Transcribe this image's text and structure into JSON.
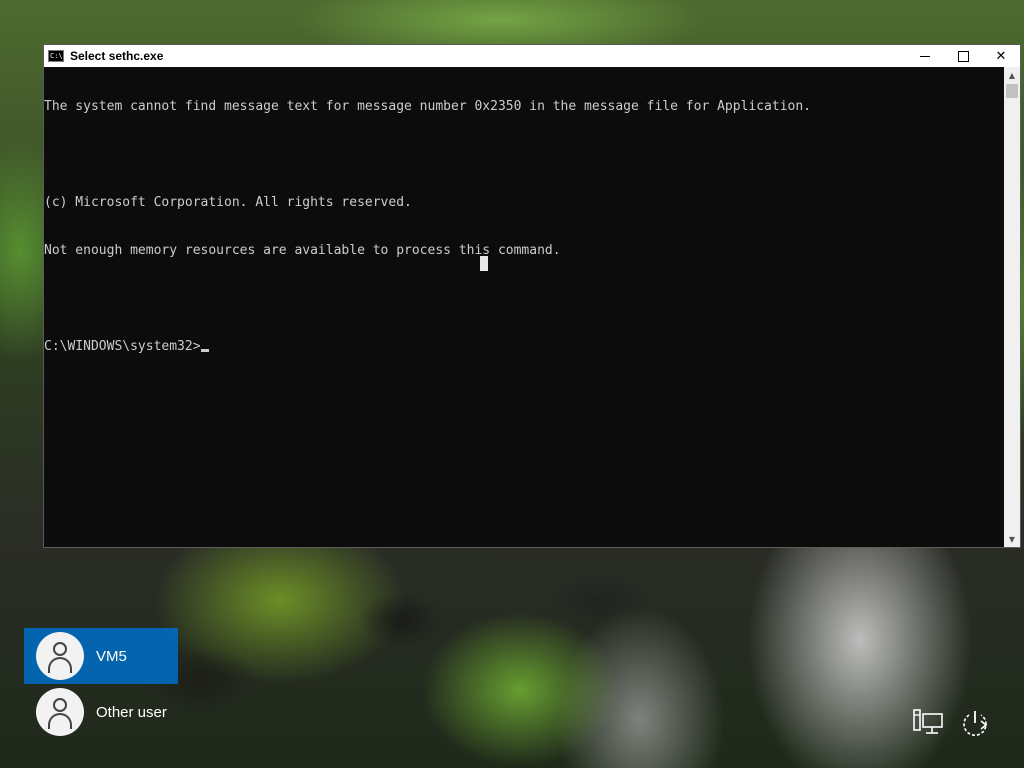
{
  "console": {
    "title": "Select sethc.exe",
    "icon": "console-icon",
    "icon_text": "C:\\",
    "lines": [
      "The system cannot find message text for message number 0x2350 in the message file for Application.",
      "",
      "(c) Microsoft Corporation. All rights reserved.",
      "Not enough memory resources are available to process this command.",
      "",
      "C:\\WINDOWS\\system32>"
    ],
    "text_color": "#cccccc",
    "background_color": "#0c0c0c",
    "controls": {
      "minimize": "minimize-icon",
      "maximize": "maximize-icon",
      "close_glyph": "✕"
    }
  },
  "users": [
    {
      "name": "VM5",
      "selected": true
    },
    {
      "name": "Other user",
      "selected": false
    }
  ],
  "system_icons": [
    "network-icon",
    "power-icon"
  ],
  "accent_color": "#006ec8"
}
